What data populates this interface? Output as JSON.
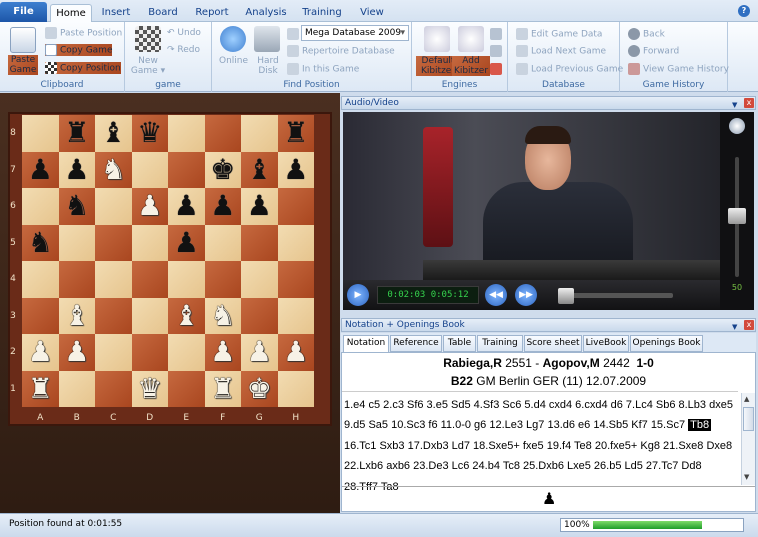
{
  "tabs": {
    "file": "File",
    "home": "Home",
    "insert": "Insert",
    "board": "Board",
    "report": "Report",
    "analysis": "Analysis",
    "training": "Training",
    "view": "View",
    "help": "?"
  },
  "clipboard": {
    "paste_game": "Paste Game",
    "paste_position": "Paste Position",
    "copy_game": "Copy Game",
    "copy_position": "Copy Position",
    "label": "Clipboard"
  },
  "game_group": {
    "new_game": "New Game",
    "undo": "Undo",
    "redo": "Redo",
    "label": "game"
  },
  "find_position": {
    "online": "Online",
    "hard_disk": "Hard Disk",
    "database": "Mega Database 2009",
    "repertoire": "Repertoire Database",
    "in_this_game": "In this Game",
    "label": "Find Position"
  },
  "engines": {
    "default_kibitzer": "Default Kibitzer",
    "add_kibitzer": "Add Kibitzer",
    "label": "Engines"
  },
  "database_group": {
    "edit_game_data": "Edit Game Data",
    "load_next": "Load Next Game",
    "load_previous": "Load Previous Game",
    "label": "Database"
  },
  "history": {
    "back": "Back",
    "forward": "Forward",
    "view_history": "View Game History",
    "label": "Game History"
  },
  "board": {
    "ranks": [
      "8",
      "7",
      "6",
      "5",
      "4",
      "3",
      "2",
      "1"
    ],
    "files": [
      "A",
      "B",
      "C",
      "D",
      "E",
      "F",
      "G",
      "H"
    ],
    "pieces": [
      {
        "sq": "b8",
        "p": "♜",
        "c": "b"
      },
      {
        "sq": "c8",
        "p": "♝",
        "c": "b"
      },
      {
        "sq": "d8",
        "p": "♛",
        "c": "b"
      },
      {
        "sq": "h8",
        "p": "♜",
        "c": "b"
      },
      {
        "sq": "a7",
        "p": "♟",
        "c": "b"
      },
      {
        "sq": "b7",
        "p": "♟",
        "c": "b"
      },
      {
        "sq": "c7",
        "p": "♞",
        "c": "w"
      },
      {
        "sq": "f7",
        "p": "♚",
        "c": "b"
      },
      {
        "sq": "g7",
        "p": "♝",
        "c": "b"
      },
      {
        "sq": "h7",
        "p": "♟",
        "c": "b"
      },
      {
        "sq": "b6",
        "p": "♞",
        "c": "b"
      },
      {
        "sq": "d6",
        "p": "♟",
        "c": "w"
      },
      {
        "sq": "e6",
        "p": "♟",
        "c": "b"
      },
      {
        "sq": "f6",
        "p": "♟",
        "c": "b"
      },
      {
        "sq": "g6",
        "p": "♟",
        "c": "b"
      },
      {
        "sq": "a5",
        "p": "♞",
        "c": "b"
      },
      {
        "sq": "e5",
        "p": "♟",
        "c": "b"
      },
      {
        "sq": "b3",
        "p": "♝",
        "c": "w"
      },
      {
        "sq": "e3",
        "p": "♝",
        "c": "w"
      },
      {
        "sq": "f3",
        "p": "♞",
        "c": "w"
      },
      {
        "sq": "a2",
        "p": "♟",
        "c": "w"
      },
      {
        "sq": "b2",
        "p": "♟",
        "c": "w"
      },
      {
        "sq": "f2",
        "p": "♟",
        "c": "w"
      },
      {
        "sq": "g2",
        "p": "♟",
        "c": "w"
      },
      {
        "sq": "h2",
        "p": "♟",
        "c": "w"
      },
      {
        "sq": "a1",
        "p": "♜",
        "c": "w"
      },
      {
        "sq": "d1",
        "p": "♛",
        "c": "w"
      },
      {
        "sq": "f1",
        "p": "♜",
        "c": "w"
      },
      {
        "sq": "g1",
        "p": "♚",
        "c": "w"
      }
    ]
  },
  "video": {
    "title": "Audio/Video",
    "time": "0:02:03 0:05:12",
    "volume": "50"
  },
  "notation": {
    "panel_title": "Notation + Openings Book",
    "tabs": [
      "Notation",
      "Reference",
      "Table",
      "Training",
      "Score sheet",
      "LiveBook",
      "Openings Book"
    ],
    "white": "Rabiega,R",
    "white_elo": "2551",
    "dash": "-",
    "black": "Agopov,M",
    "black_elo": "2442",
    "result": "1-0",
    "eco": "B22",
    "event": "GM Berlin GER (11) 12.07.2009",
    "moves_before": "1.e4  c5  2.c3  Sf6  3.e5  Sd5  4.Sf3  Sc6  5.d4  cxd4  6.cxd4  d6  7.Lc4  Sb6  8.Lb3  dxe5  9.d5  Sa5  10.Sc3  f6  11.0-0  g6  12.Le3  Lg7  13.d6  e6  14.Sb5  Kf7  15.Sc7 ",
    "current_move": "Tb8",
    "moves_after": "  16.Tc1  Sxb3  17.Dxb3  Ld7  18.Sxe5+  fxe5  19.f4  Te8  20.fxe5+  Kg8  21.Sxe8  Dxe8  22.Lxb6  axb6  23.De3  Lc6  24.b4  Tc8  25.Dxb6  Lxe5  26.b5  Ld5  27.Tc7  Dd8  28.Tff7  Ta8",
    "side_to_move": "♟"
  },
  "status": {
    "text": "Position found at 0:01:55",
    "zoom": "100%",
    "progress": 0.75
  }
}
